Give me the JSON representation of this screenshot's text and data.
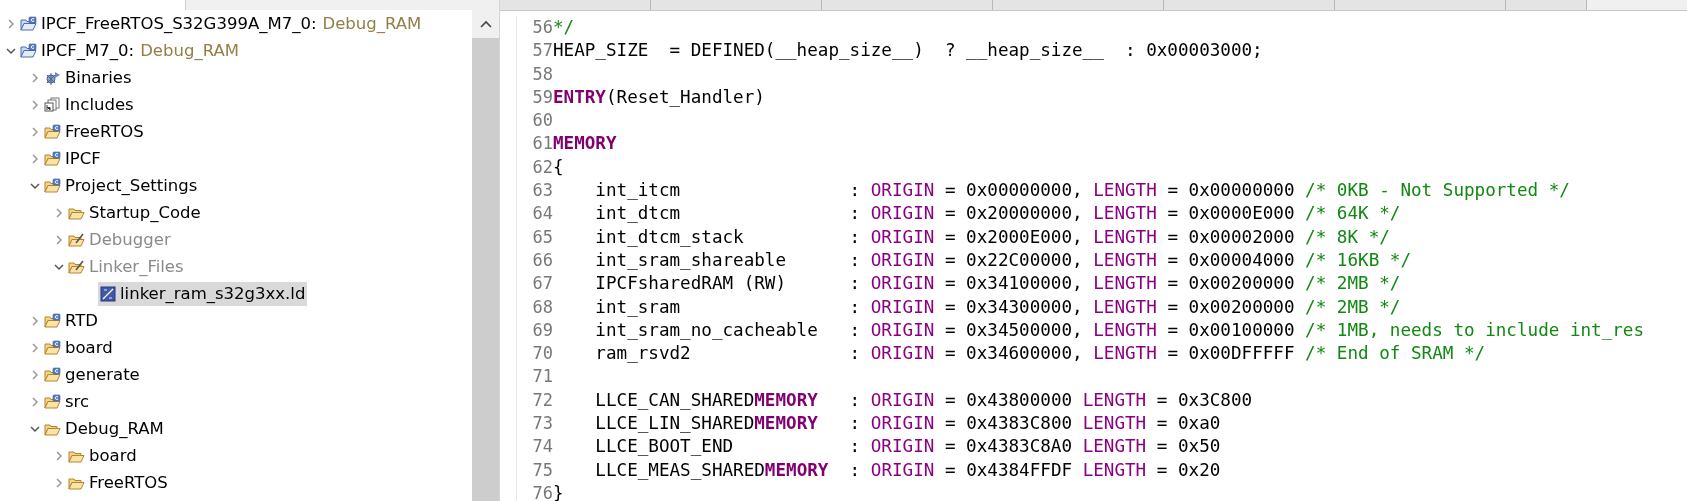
{
  "explorer": {
    "tree": [
      {
        "label": "IPCF_FreeRTOS_S32G399A_M7_0:",
        "config": "Debug_RAM",
        "kind": "project",
        "expanded": false,
        "selected": false
      },
      {
        "label": "IPCF_M7_0:",
        "config": "Debug_RAM",
        "kind": "project",
        "expanded": true,
        "selected": false,
        "children": [
          {
            "label": "Binaries",
            "kind": "binaries",
            "expanded": false,
            "selected": false
          },
          {
            "label": "Includes",
            "kind": "includes",
            "expanded": false,
            "selected": false
          },
          {
            "label": "FreeRTOS",
            "kind": "source-folder",
            "expanded": false,
            "selected": false
          },
          {
            "label": "IPCF",
            "kind": "source-folder",
            "expanded": false,
            "selected": false
          },
          {
            "label": "Project_Settings",
            "kind": "source-folder",
            "expanded": true,
            "selected": false,
            "children": [
              {
                "label": "Startup_Code",
                "kind": "folder",
                "expanded": false,
                "selected": false
              },
              {
                "label": "Debugger",
                "kind": "excluded-folder",
                "excluded": true,
                "expanded": false,
                "selected": false
              },
              {
                "label": "Linker_Files",
                "kind": "excluded-folder",
                "excluded": true,
                "expanded": true,
                "selected": false,
                "children": [
                  {
                    "label": "linker_ram_s32g3xx.ld",
                    "kind": "linker-file",
                    "selected": true
                  }
                ]
              }
            ]
          },
          {
            "label": "RTD",
            "kind": "source-folder",
            "expanded": false,
            "selected": false
          },
          {
            "label": "board",
            "kind": "source-folder",
            "expanded": false,
            "selected": false
          },
          {
            "label": "generate",
            "kind": "source-folder",
            "expanded": false,
            "selected": false
          },
          {
            "label": "src",
            "kind": "source-folder",
            "expanded": false,
            "selected": false
          },
          {
            "label": "Debug_RAM",
            "kind": "folder",
            "expanded": true,
            "selected": false,
            "children": [
              {
                "label": "board",
                "kind": "folder",
                "expanded": false,
                "selected": false
              },
              {
                "label": "FreeRTOS",
                "kind": "folder",
                "expanded": false,
                "selected": false
              }
            ]
          }
        ]
      }
    ]
  },
  "editor": {
    "lines": [
      {
        "number": "56",
        "tokens": [
          {
            "kind": "comment",
            "text": "*/"
          }
        ]
      },
      {
        "number": "57",
        "tokens": [
          {
            "kind": "plain",
            "text": "HEAP_SIZE  = DEFINED(__heap_size__)  ? __heap_size__  : 0x00003000;"
          }
        ]
      },
      {
        "number": "58"
      },
      {
        "number": "59",
        "tokens": [
          {
            "kind": "keyword",
            "text": "ENTRY"
          },
          {
            "kind": "plain",
            "text": "(Reset_Handler)"
          }
        ]
      },
      {
        "number": "60"
      },
      {
        "number": "61",
        "tokens": [
          {
            "kind": "keyword",
            "text": "MEMORY"
          }
        ]
      },
      {
        "number": "62",
        "tokens": [
          {
            "kind": "plain",
            "text": "{"
          }
        ]
      },
      {
        "number": "63",
        "tokens": [
          {
            "kind": "plain",
            "text": "    int_itcm                : "
          },
          {
            "kind": "attr",
            "text": "ORIGIN"
          },
          {
            "kind": "plain",
            "text": " = 0x00000000, "
          },
          {
            "kind": "attr",
            "text": "LENGTH"
          },
          {
            "kind": "plain",
            "text": " = 0x00000000 "
          },
          {
            "kind": "comment",
            "text": "/* 0KB - Not Supported */"
          }
        ]
      },
      {
        "number": "64",
        "tokens": [
          {
            "kind": "plain",
            "text": "    int_dtcm                : "
          },
          {
            "kind": "attr",
            "text": "ORIGIN"
          },
          {
            "kind": "plain",
            "text": " = 0x20000000, "
          },
          {
            "kind": "attr",
            "text": "LENGTH"
          },
          {
            "kind": "plain",
            "text": " = 0x0000E000 "
          },
          {
            "kind": "comment",
            "text": "/* 64K */"
          }
        ]
      },
      {
        "number": "65",
        "tokens": [
          {
            "kind": "plain",
            "text": "    int_dtcm_stack          : "
          },
          {
            "kind": "attr",
            "text": "ORIGIN"
          },
          {
            "kind": "plain",
            "text": " = 0x2000E000, "
          },
          {
            "kind": "attr",
            "text": "LENGTH"
          },
          {
            "kind": "plain",
            "text": " = 0x00002000 "
          },
          {
            "kind": "comment",
            "text": "/* 8K */"
          }
        ]
      },
      {
        "number": "66",
        "tokens": [
          {
            "kind": "plain",
            "text": "    int_sram_shareable      : "
          },
          {
            "kind": "attr",
            "text": "ORIGIN"
          },
          {
            "kind": "plain",
            "text": " = 0x22C00000, "
          },
          {
            "kind": "attr",
            "text": "LENGTH"
          },
          {
            "kind": "plain",
            "text": " = 0x00004000 "
          },
          {
            "kind": "comment",
            "text": "/* 16KB */"
          }
        ]
      },
      {
        "number": "67",
        "tokens": [
          {
            "kind": "plain",
            "text": "    IPCFsharedRAM (RW)      : "
          },
          {
            "kind": "attr",
            "text": "ORIGIN"
          },
          {
            "kind": "plain",
            "text": " = 0x34100000, "
          },
          {
            "kind": "attr",
            "text": "LENGTH"
          },
          {
            "kind": "plain",
            "text": " = 0x00200000 "
          },
          {
            "kind": "comment",
            "text": "/* 2MB */"
          }
        ]
      },
      {
        "number": "68",
        "tokens": [
          {
            "kind": "plain",
            "text": "    int_sram                : "
          },
          {
            "kind": "attr",
            "text": "ORIGIN"
          },
          {
            "kind": "plain",
            "text": " = 0x34300000, "
          },
          {
            "kind": "attr",
            "text": "LENGTH"
          },
          {
            "kind": "plain",
            "text": " = 0x00200000 "
          },
          {
            "kind": "comment",
            "text": "/* 2MB */"
          }
        ]
      },
      {
        "number": "69",
        "tokens": [
          {
            "kind": "plain",
            "text": "    int_sram_no_cacheable   : "
          },
          {
            "kind": "attr",
            "text": "ORIGIN"
          },
          {
            "kind": "plain",
            "text": " = 0x34500000, "
          },
          {
            "kind": "attr",
            "text": "LENGTH"
          },
          {
            "kind": "plain",
            "text": " = 0x00100000 "
          },
          {
            "kind": "comment",
            "text": "/* 1MB, needs to include int_res"
          }
        ]
      },
      {
        "number": "70",
        "tokens": [
          {
            "kind": "plain",
            "text": "    ram_rsvd2               : "
          },
          {
            "kind": "attr",
            "text": "ORIGIN"
          },
          {
            "kind": "plain",
            "text": " = 0x34600000, "
          },
          {
            "kind": "attr",
            "text": "LENGTH"
          },
          {
            "kind": "plain",
            "text": " = 0x00DFFFFF "
          },
          {
            "kind": "comment",
            "text": "/* End of SRAM */"
          }
        ]
      },
      {
        "number": "71"
      },
      {
        "number": "72",
        "tokens": [
          {
            "kind": "plain",
            "text": "    LLCE_CAN_SHARED"
          },
          {
            "kind": "keyword",
            "text": "MEMORY"
          },
          {
            "kind": "plain",
            "text": "   : "
          },
          {
            "kind": "attr",
            "text": "ORIGIN"
          },
          {
            "kind": "plain",
            "text": " = 0x43800000 "
          },
          {
            "kind": "attr",
            "text": "LENGTH"
          },
          {
            "kind": "plain",
            "text": " = 0x3C800"
          }
        ]
      },
      {
        "number": "73",
        "tokens": [
          {
            "kind": "plain",
            "text": "    LLCE_LIN_SHARED"
          },
          {
            "kind": "keyword",
            "text": "MEMORY"
          },
          {
            "kind": "plain",
            "text": "   : "
          },
          {
            "kind": "attr",
            "text": "ORIGIN"
          },
          {
            "kind": "plain",
            "text": " = 0x4383C800 "
          },
          {
            "kind": "attr",
            "text": "LENGTH"
          },
          {
            "kind": "plain",
            "text": " = 0xa0"
          }
        ]
      },
      {
        "number": "74",
        "tokens": [
          {
            "kind": "plain",
            "text": "    LLCE_BOOT_END           : "
          },
          {
            "kind": "attr",
            "text": "ORIGIN"
          },
          {
            "kind": "plain",
            "text": " = 0x4383C8A0 "
          },
          {
            "kind": "attr",
            "text": "LENGTH"
          },
          {
            "kind": "plain",
            "text": " = 0x50"
          }
        ]
      },
      {
        "number": "75",
        "tokens": [
          {
            "kind": "plain",
            "text": "    LLCE_MEAS_SHARED"
          },
          {
            "kind": "keyword",
            "text": "MEMORY"
          },
          {
            "kind": "plain",
            "text": "  : "
          },
          {
            "kind": "attr",
            "text": "ORIGIN"
          },
          {
            "kind": "plain",
            "text": " = 0x4384FFDF "
          },
          {
            "kind": "attr",
            "text": "LENGTH"
          },
          {
            "kind": "plain",
            "text": " = 0x20"
          }
        ]
      },
      {
        "number": "76",
        "tokens": [
          {
            "kind": "plain",
            "text": "}"
          }
        ]
      }
    ]
  }
}
